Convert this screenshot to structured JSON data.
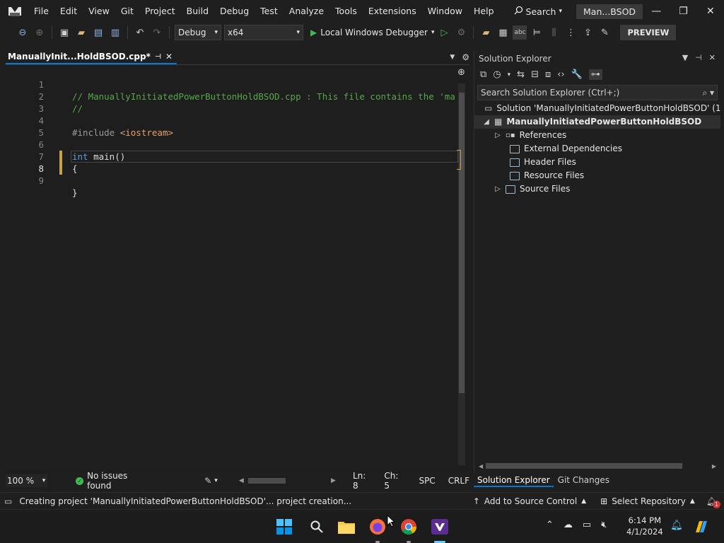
{
  "menubar": {
    "items": [
      "File",
      "Edit",
      "View",
      "Git",
      "Project",
      "Build",
      "Debug",
      "Test",
      "Analyze",
      "Tools",
      "Extensions",
      "Window",
      "Help"
    ],
    "search_label": "Search",
    "window_title": "Man...BSOD"
  },
  "toolbar": {
    "config": "Debug",
    "platform": "x64",
    "run_label": "Local Windows Debugger",
    "preview_label": "PREVIEW"
  },
  "editor": {
    "tab_title": "ManuallyInit...HoldBSOD.cpp*",
    "line_numbers": [
      "1",
      "2",
      "3",
      "4",
      "5",
      "6",
      "7",
      "8",
      "9"
    ],
    "lines": {
      "l1": "// ManuallyInitiatedPowerButtonHoldBSOD.cpp : This file contains the 'ma",
      "l2": "//",
      "l4a": "#include ",
      "l4b": "<iostream>",
      "l6a": "int",
      "l6b": " main()",
      "l7": "{",
      "l9": "}"
    }
  },
  "editor_status": {
    "zoom": "100 %",
    "issues": "No issues found",
    "line": "Ln: 8",
    "col": "Ch: 5",
    "spacing": "SPC",
    "eol": "CRLF"
  },
  "solution_explorer": {
    "title": "Solution Explorer",
    "search_placeholder": "Search Solution Explorer (Ctrl+;)",
    "solution_row": "Solution 'ManuallyInitiatedPowerButtonHoldBSOD' (1 of 1 p",
    "project_row": "ManuallyInitiatedPowerButtonHoldBSOD",
    "children": [
      "References",
      "External Dependencies",
      "Header Files",
      "Resource Files",
      "Source Files"
    ],
    "tabs": [
      "Solution Explorer",
      "Git Changes"
    ]
  },
  "statusbar": {
    "message": "Creating project 'ManuallyInitiatedPowerButtonHoldBSOD'... project creation...",
    "add_source": "Add to Source Control",
    "select_repo": "Select Repository",
    "notif_count": "1"
  },
  "taskbar": {
    "time": "6:14 PM",
    "date": "4/1/2024"
  },
  "colors": {
    "accent": "#0078d4",
    "success": "#3fb950",
    "comment": "#57a64a",
    "keyword": "#569cd6"
  }
}
